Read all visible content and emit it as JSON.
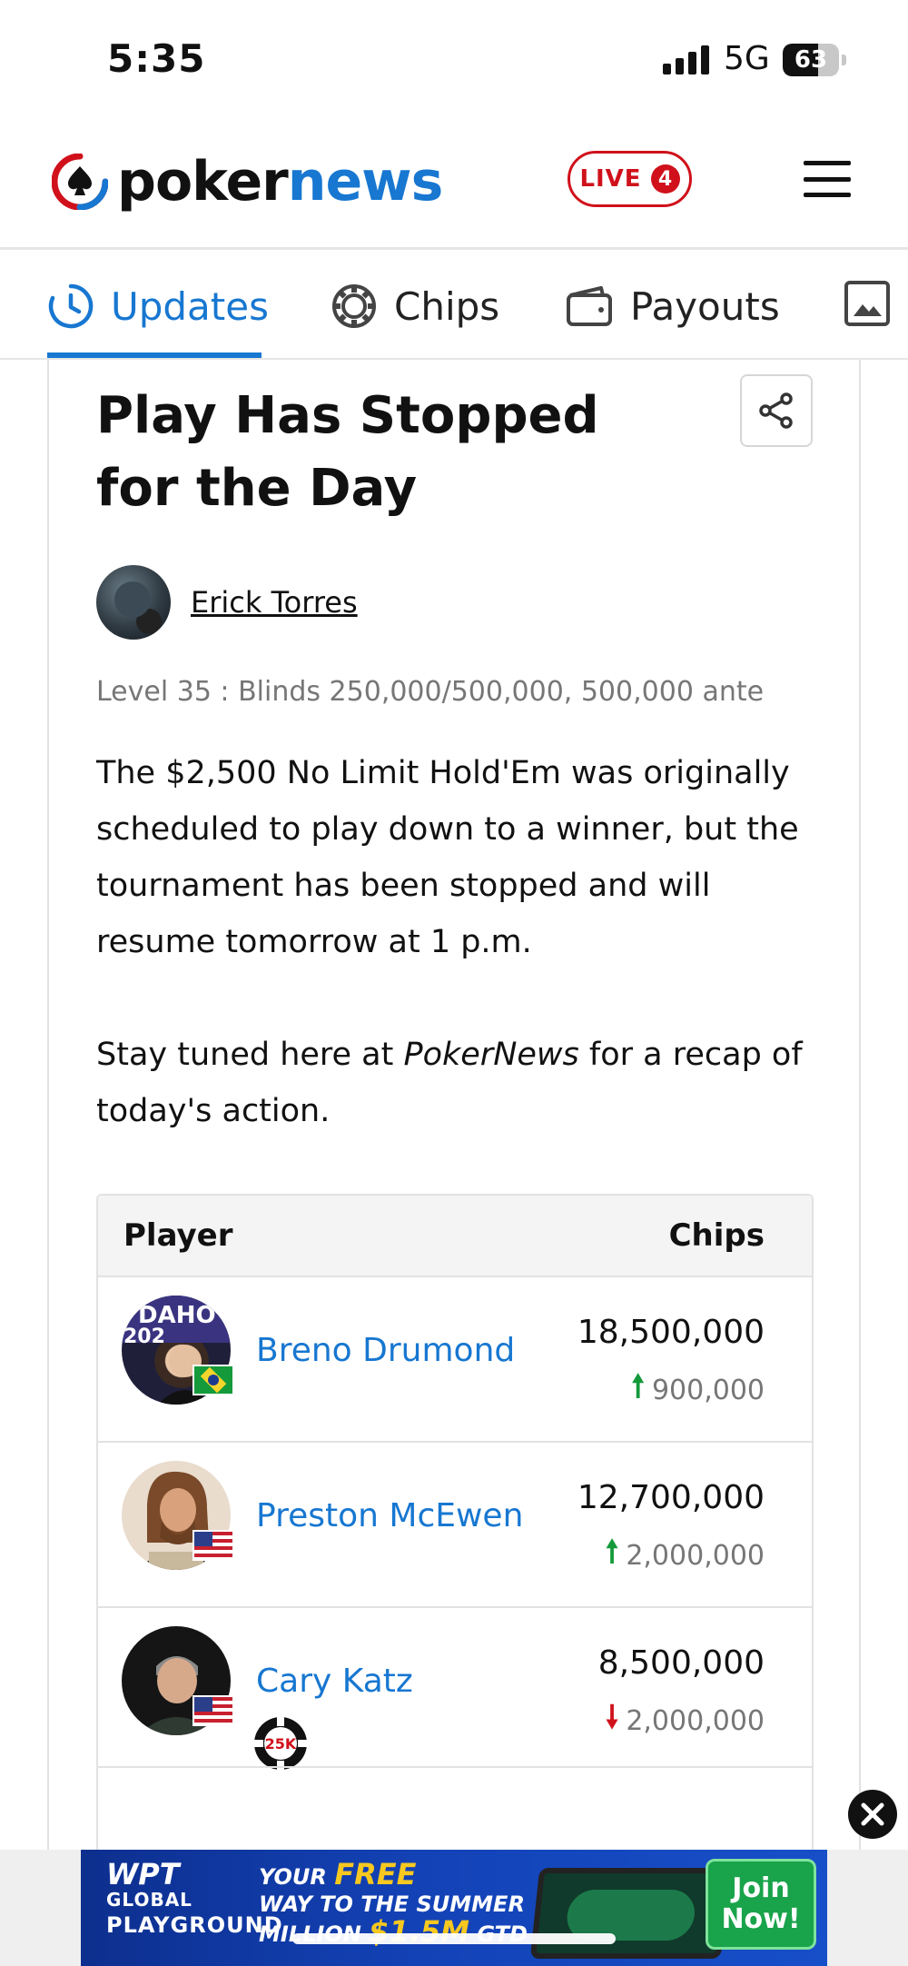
{
  "status_bar": {
    "time": "5:35",
    "network": "5G",
    "battery": "63"
  },
  "header": {
    "logo_part1": "poker",
    "logo_part2": "news",
    "live_label": "LIVE",
    "live_count": "4",
    "menu_icon": "hamburger-icon"
  },
  "tabs": [
    {
      "label": "Updates",
      "icon": "clock-icon",
      "active": true
    },
    {
      "label": "Chips",
      "icon": "poker-chip-icon",
      "active": false
    },
    {
      "label": "Payouts",
      "icon": "wallet-icon",
      "active": false
    }
  ],
  "post": {
    "title": "Play Has Stopped for the Day",
    "author": "Erick Torres",
    "level": "Level 35 : Blinds 250,000/500,000, 500,000 ante",
    "para1": "The $2,500 No Limit Hold'Em was originally scheduled to play down to a winner, but the tournament has been stopped and will resume tomorrow at 1 p.m.",
    "para2_before": "Stay tuned here at ",
    "para2_em": "PokerNews",
    "para2_after": " for a recap of today's action."
  },
  "table": {
    "headers": {
      "player": "Player",
      "chips": "Chips"
    },
    "rows": [
      {
        "name": "Breno Drumond",
        "chips": "18,500,000",
        "change": "900,000",
        "direction": "up",
        "flag": "Brazil"
      },
      {
        "name": "Preston McEwen",
        "chips": "12,700,000",
        "change": "2,000,000",
        "direction": "up",
        "flag": "United States"
      },
      {
        "name": "Cary Katz",
        "chips": "8,500,000",
        "change": "2,000,000",
        "direction": "down",
        "flag": "United States",
        "badge": "25K"
      }
    ]
  },
  "ad": {
    "brand_wpt": "WPT",
    "brand_global": "GLOBAL",
    "brand_playground": "PLAYGROUND",
    "line1_a": "YOUR ",
    "line1_b": "FREE",
    "line2": "WAY TO THE SUMMER",
    "line3_a": "MILLION ",
    "line3_b": "$1.5M",
    "line3_c": " GTD",
    "cta": "Join Now!",
    "colors": {
      "brand_blue": "#1777d1",
      "live_red": "#d0111b",
      "up_green": "#149a3a"
    }
  }
}
